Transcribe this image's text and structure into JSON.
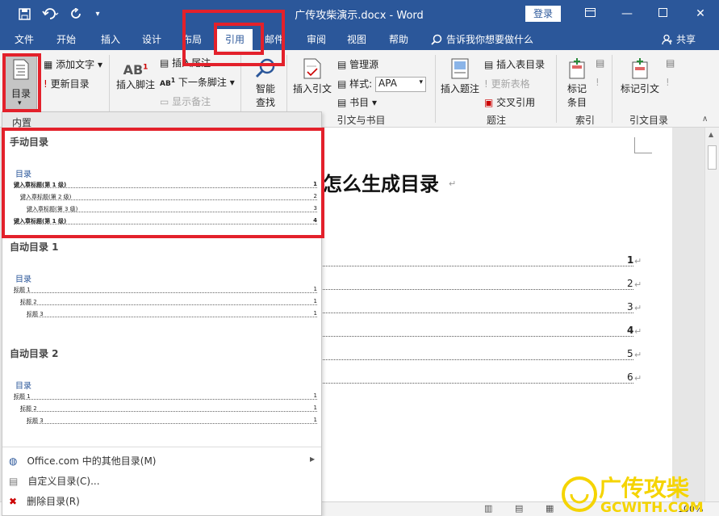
{
  "titlebar": {
    "doc_title": "广传攻柴演示.docx - Word",
    "login_label": "登录",
    "save_icon": "save-icon",
    "undo_icon": "undo-icon",
    "redo_icon": "redo-icon"
  },
  "tabs": [
    "文件",
    "开始",
    "插入",
    "设计",
    "布局",
    "引用",
    "邮件",
    "审阅",
    "视图",
    "帮助"
  ],
  "active_tab": "引用",
  "tellme": "告诉我你想要做什么",
  "share": "共享",
  "ribbon": {
    "toc_label": "目录",
    "add_text": "添加文字",
    "update_toc": "更新目录",
    "insert_footnote": "插入脚注",
    "insert_endnote": "插入尾注",
    "next_footnote": "下一条脚注",
    "show_notes": "显示备注",
    "smart_lookup_1": "智能",
    "smart_lookup_2": "查找",
    "insert_citation": "插入引文",
    "manage_sources": "管理源",
    "style_label": "样式:",
    "style_value": "APA",
    "bibliography": "书目",
    "citations_group": "引文与书目",
    "insert_caption": "插入题注",
    "insert_table_figures": "插入表目录",
    "update_table": "更新表格",
    "cross_ref": "交叉引用",
    "captions_group": "题注",
    "mark_entry_1": "标记",
    "mark_entry_2": "条目",
    "index_group": "索引",
    "mark_citation": "标记引文",
    "toa_group": "引文目录"
  },
  "dropdown": {
    "header": "内置",
    "manual_title": "手动目录",
    "manual_toc": "目录",
    "manual_rows": [
      {
        "text": "键入章标题(第 1 级)",
        "num": "1"
      },
      {
        "text": "键入章标题(第 2 级)",
        "num": "2"
      },
      {
        "text": "键入章标题(第 3 级)",
        "num": "3"
      },
      {
        "text": "键入章标题(第 1 级)",
        "num": "4"
      }
    ],
    "auto1_title": "自动目录 1",
    "auto1_toc": "目录",
    "auto1_rows": [
      {
        "text": "标题 1",
        "num": "1"
      },
      {
        "text": "标题 2",
        "num": "1"
      },
      {
        "text": "标题 3",
        "num": "1"
      }
    ],
    "auto2_title": "自动目录 2",
    "auto2_toc": "目录",
    "auto2_rows": [
      {
        "text": "标题 1",
        "num": "1"
      },
      {
        "text": "标题 2",
        "num": "1"
      },
      {
        "text": "标题 3",
        "num": "1"
      }
    ],
    "more_toc": "Office.com 中的其他目录(M)",
    "custom_toc": "自定义目录(C)...",
    "remove_toc": "删除目录(R)"
  },
  "document": {
    "heading": "怎么生成目录",
    "toc_nums": [
      "1",
      "2",
      "3",
      "4",
      "5",
      "6"
    ]
  },
  "status": {
    "zoom": "100%"
  },
  "watermark": {
    "line1": "广传攻柴",
    "line2": "GCWITH.COM"
  },
  "colors": {
    "accent": "#2b579a",
    "highlight": "#e3212b",
    "watermark": "#f5d400"
  }
}
